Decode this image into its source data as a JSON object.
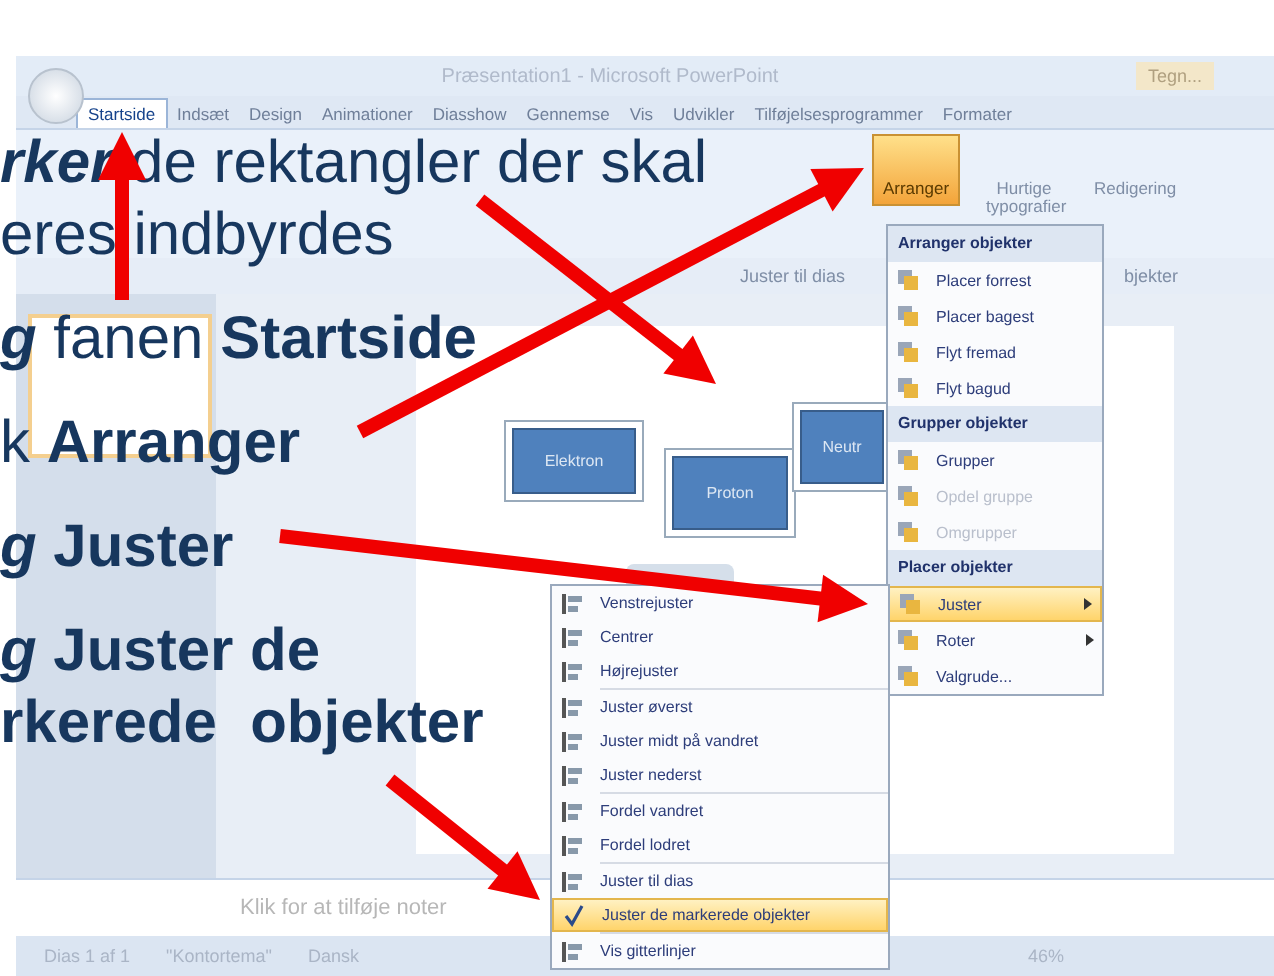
{
  "window": {
    "title": "Præsentation1 - Microsoft PowerPoint",
    "context_tab": "Tegn..."
  },
  "tabs": [
    {
      "label": "Startside",
      "selected": true
    },
    {
      "label": "Indsæt",
      "selected": false
    },
    {
      "label": "Design",
      "selected": false
    },
    {
      "label": "Animationer",
      "selected": false
    },
    {
      "label": "Diasshow",
      "selected": false
    },
    {
      "label": "Gennemse",
      "selected": false
    },
    {
      "label": "Vis",
      "selected": false
    },
    {
      "label": "Udvikler",
      "selected": false
    },
    {
      "label": "Tilføjelsesprogrammer",
      "selected": false
    },
    {
      "label": "Formater",
      "selected": false
    }
  ],
  "ribbon": {
    "buttons": [
      {
        "label": "Arranger",
        "selected": true
      },
      {
        "label": "Hurtige typografier",
        "selected": false
      },
      {
        "label": "Redigering",
        "selected": false
      }
    ]
  },
  "toolbar": {
    "labels": [
      "Juster til dias",
      "bjekter"
    ]
  },
  "slide": {
    "shapes": [
      {
        "label": "Elektron"
      },
      {
        "label": "Proton"
      },
      {
        "label": "Neutr"
      }
    ]
  },
  "notes": {
    "placeholder": "Klik for at tilføje noter"
  },
  "status_bar": {
    "items": [
      "Dias 1 af 1",
      "\"Kontortema\"",
      "Dansk"
    ],
    "zoom": "46%"
  },
  "arrange_menu": {
    "sections": [
      {
        "header": "Arranger objekter",
        "items": [
          {
            "label": "Placer forrest",
            "selected": false,
            "disabled": false,
            "submenu": false
          },
          {
            "label": "Placer bagest",
            "selected": false,
            "disabled": false,
            "submenu": false
          },
          {
            "label": "Flyt fremad",
            "selected": false,
            "disabled": false,
            "submenu": false
          },
          {
            "label": "Flyt bagud",
            "selected": false,
            "disabled": false,
            "submenu": false
          }
        ]
      },
      {
        "header": "Grupper objekter",
        "items": [
          {
            "label": "Grupper",
            "selected": false,
            "disabled": false,
            "submenu": false
          },
          {
            "label": "Opdel gruppe",
            "selected": false,
            "disabled": true,
            "submenu": false
          },
          {
            "label": "Omgrupper",
            "selected": false,
            "disabled": true,
            "submenu": false
          }
        ]
      },
      {
        "header": "Placer objekter",
        "items": [
          {
            "label": "Juster",
            "selected": true,
            "disabled": false,
            "submenu": true
          },
          {
            "label": "Roter",
            "selected": false,
            "disabled": false,
            "submenu": true
          },
          {
            "label": "Valgrude...",
            "selected": false,
            "disabled": false,
            "submenu": false
          }
        ]
      }
    ]
  },
  "align_menu": {
    "groups": [
      [
        {
          "label": "Venstrejuster",
          "checked": false
        },
        {
          "label": "Centrer",
          "checked": false
        },
        {
          "label": "Højrejuster",
          "checked": false
        }
      ],
      [
        {
          "label": "Juster øverst",
          "checked": false
        },
        {
          "label": "Juster midt på vandret",
          "checked": false
        },
        {
          "label": "Juster nederst",
          "checked": false
        }
      ],
      [
        {
          "label": "Fordel vandret",
          "checked": false
        },
        {
          "label": "Fordel lodret",
          "checked": false
        }
      ],
      [
        {
          "label": "Juster til dias",
          "checked": false
        },
        {
          "label": "Juster de markerede objekter",
          "checked": true
        }
      ],
      [
        {
          "label": "Vis gitterlinjer",
          "checked": false
        }
      ]
    ]
  },
  "instructions": [
    {
      "lines": [
        [
          {
            "text": "rker",
            "kind": "bold-italic"
          },
          {
            "text": " de rektangler der skal",
            "kind": "normal"
          }
        ],
        [
          {
            "text": "eres indbyrdes",
            "kind": "normal"
          }
        ]
      ]
    },
    {
      "lines": [
        [
          {
            "text": "g",
            "kind": "bold-italic"
          },
          {
            "text": " fanen ",
            "kind": "normal"
          },
          {
            "text": "Startside",
            "kind": "bold"
          }
        ]
      ]
    },
    {
      "lines": [
        [
          {
            "text": "k ",
            "kind": "normal"
          },
          {
            "text": "Arranger",
            "kind": "bold"
          }
        ]
      ]
    },
    {
      "lines": [
        [
          {
            "text": "g",
            "kind": "bold-italic"
          },
          {
            "text": " Juster",
            "kind": "bold"
          }
        ]
      ]
    },
    {
      "lines": [
        [
          {
            "text": "g",
            "kind": "bold-italic"
          },
          {
            "text": " Juster de",
            "kind": "bold"
          }
        ],
        [
          {
            "text": "rkerede  objekter",
            "kind": "bold"
          }
        ]
      ]
    }
  ]
}
